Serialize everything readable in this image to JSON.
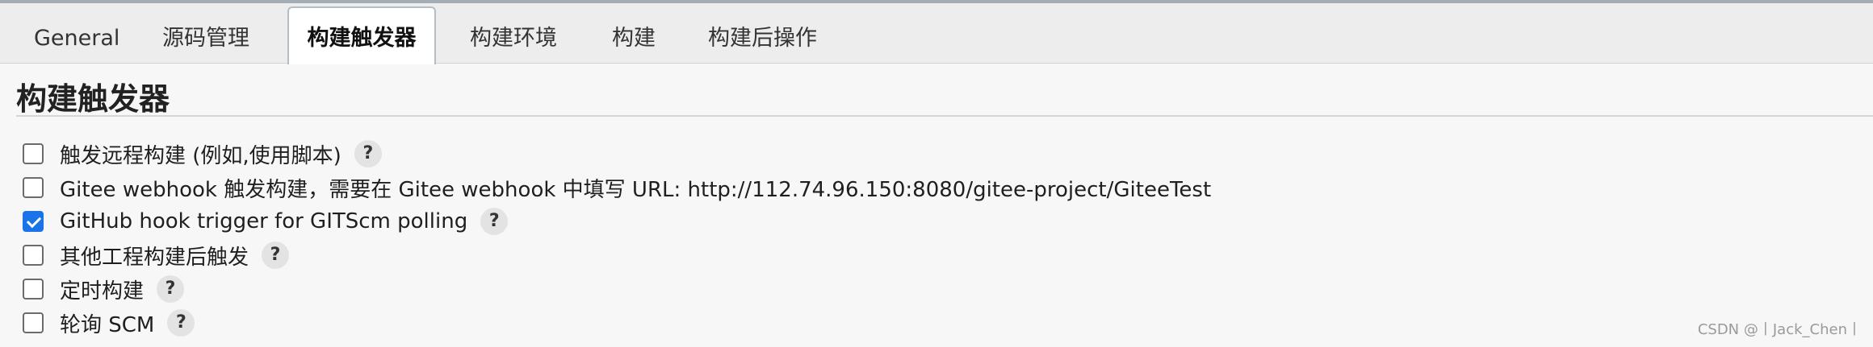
{
  "tabs": [
    {
      "label": "General",
      "active": false
    },
    {
      "label": "源码管理",
      "active": false
    },
    {
      "label": "构建触发器",
      "active": true
    },
    {
      "label": "构建环境",
      "active": false
    },
    {
      "label": "构建",
      "active": false
    },
    {
      "label": "构建后操作",
      "active": false
    }
  ],
  "section": {
    "title": "构建触发器"
  },
  "options": [
    {
      "label": "触发远程构建 (例如,使用脚本)",
      "checked": false,
      "help": "?"
    },
    {
      "label": "Gitee webhook 触发构建，需要在 Gitee webhook 中填写 URL: http://112.74.96.150:8080/gitee-project/GiteeTest",
      "checked": false
    },
    {
      "label": "GitHub hook trigger for GITScm polling",
      "checked": true,
      "help": "?"
    },
    {
      "label": "其他工程构建后触发",
      "checked": false,
      "help": "?"
    },
    {
      "label": "定时构建",
      "checked": false,
      "help": "?"
    },
    {
      "label": "轮询 SCM",
      "checked": false,
      "help": "?"
    }
  ],
  "watermark": "CSDN @丨Jack_Chen丨",
  "colors": {
    "checkbox_checked": "#1a73e8",
    "tabbar_bg": "#ededed",
    "page_bg": "#f7f7f7"
  }
}
